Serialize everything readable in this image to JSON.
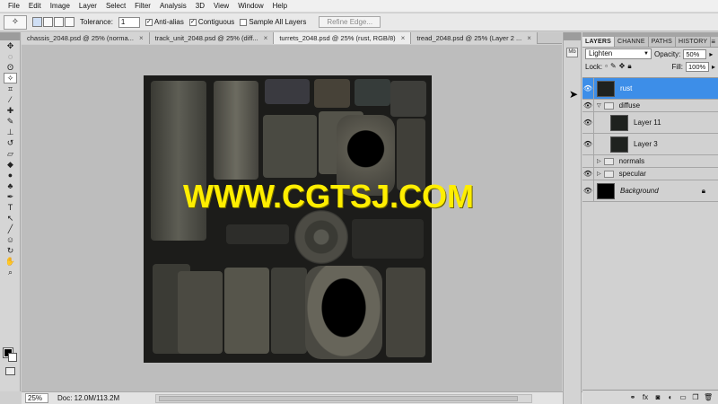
{
  "menu": [
    "File",
    "Edit",
    "Image",
    "Layer",
    "Select",
    "Filter",
    "Analysis",
    "3D",
    "View",
    "Window",
    "Help"
  ],
  "options": {
    "tolerance_label": "Tolerance:",
    "tolerance_value": "1",
    "antialias_label": "Anti-alias",
    "contiguous_label": "Contiguous",
    "sample_all_label": "Sample All Layers",
    "refine_edge_label": "Refine Edge..."
  },
  "tabs": [
    {
      "label": "chassis_2048.psd @ 25% (norma...",
      "active": false
    },
    {
      "label": "track_unit_2048.psd @ 25% (diff...",
      "active": false
    },
    {
      "label": "turrets_2048.psd @ 25% (rust, RGB/8)",
      "active": true
    },
    {
      "label": "tread_2048.psd @ 25% (Layer 2 ...",
      "active": false
    }
  ],
  "watermark": "WWW.CGTSJ.COM",
  "status": {
    "zoom": "25%",
    "doc_info": "Doc: 12.0M/113.2M"
  },
  "layers_panel": {
    "tabs": [
      "LAYERS",
      "CHANNE",
      "PATHS",
      "HISTORY"
    ],
    "blend_mode": "Lighten",
    "opacity_label": "Opacity:",
    "opacity_value": "50%",
    "lock_label": "Lock:",
    "fill_label": "Fill:",
    "fill_value": "100%",
    "layers": [
      {
        "name": "rust",
        "type": "layer",
        "selected": true
      },
      {
        "name": "diffuse",
        "type": "group",
        "expanded": true
      },
      {
        "name": "Layer 11",
        "type": "layer",
        "indent": true
      },
      {
        "name": "Layer 3",
        "type": "layer",
        "indent": true
      },
      {
        "name": "normals",
        "type": "group",
        "expanded": false
      },
      {
        "name": "specular",
        "type": "group",
        "expanded": false
      },
      {
        "name": "Background",
        "type": "background"
      }
    ]
  },
  "colors": {
    "selected_layer": "#3d8ee8",
    "watermark": "#ffee00",
    "canvas_bg": "#bdbdbd"
  }
}
